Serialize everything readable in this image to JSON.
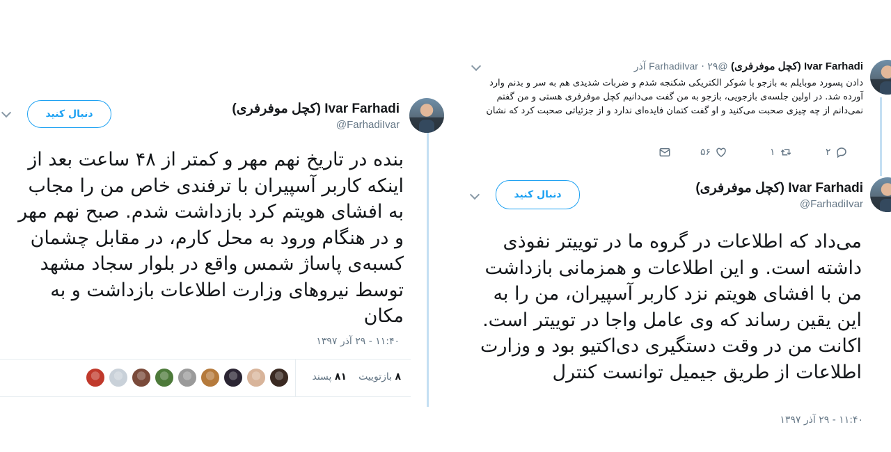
{
  "left_tweet": {
    "name": "Ivar Farhadi (کچل موفرفری)",
    "handle": "@FarhadiIvar",
    "follow_label": "دنبال کنید",
    "text": "بنده در تاریخ نهم مهر و کمتر از ۴۸ ساعت بعد از اینکه کاربر آسپیران با ترفندی خاص من را مجاب به افشای هویتم کرد بازداشت شدم. صبح نهم مهر و در هنگام ورود به محل کارم، در مقابل چشمان کسبه‌ی پاساژ شمس واقع در بلوار سجاد مشهد توسط نیروهای وزارت اطلاعات بازداشت و به مکان",
    "timestamp": "۱۱:۴۰ - ۲۹ آذر ۱۳۹۷",
    "retweets_count": "۸",
    "retweets_label": "بازتوییت",
    "likes_count": "۸۱",
    "likes_label": "پسند",
    "liker_colors": [
      "#3a2a22",
      "#d8b49a",
      "#2b2533",
      "#b57a3c",
      "#9a9a9a",
      "#4d7a3a",
      "#7a4a3a",
      "#c9d1d9",
      "#c0392b"
    ]
  },
  "right_top_tweet": {
    "name": "Ivar Farhadi (کچل موفرفری)",
    "handle": "@FarhadiIvar",
    "date": "۲۹ آذر",
    "separator": "·",
    "text": "دادن پسورد موبایلم به بازجو با شوکر الکتریکی شکنجه شدم و ضربات شدیدی هم به سر و بدنم وارد آورده شد. در اولین جلسه‌ی بازجویی، بازجو به من گفت می‌دانیم کچل موفرفری هستی و من گفتم نمی‌دانم از چه چیزی صحبت می‌کنید و او گفت کتمان فایده‌ای ندارد و از جزئیاتی صحبت کرد که نشان",
    "reply_count": "۲",
    "retweet_count": "۱",
    "like_count": "۵۶"
  },
  "right_bottom_tweet": {
    "name": "Ivar Farhadi (کچل موفرفری)",
    "handle": "@FarhadiIvar",
    "follow_label": "دنبال کنید",
    "text": "می‌داد که اطلاعات در گروه ما در توییتر نفوذی داشته است. و این اطلاعات و همزمانی بازداشت من با افشای هویتم نزد کاربر آسپیران، من را به این یقین رساند که وی عامل واجا در توییتر است. اکانت من در وقت دستگیری دی‌اکتیو بود و وزارت اطلاعات از طریق جیمیل توانست کنترل",
    "timestamp": "۱۱:۴۰ - ۲۹ آذر ۱۳۹۷"
  }
}
